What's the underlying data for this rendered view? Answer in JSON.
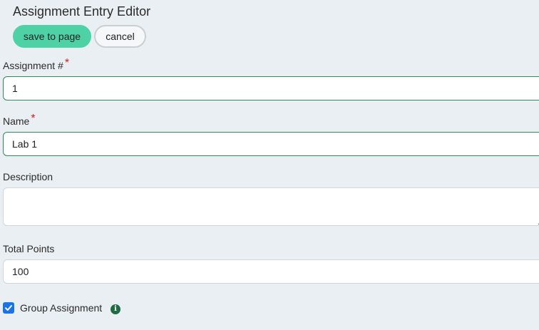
{
  "editor": {
    "title": "Assignment Entry Editor",
    "save_label": "save to page",
    "cancel_label": "cancel"
  },
  "fields": {
    "assignment_number": {
      "label": "Assignment #",
      "required_mark": "*",
      "value": "1"
    },
    "name": {
      "label": "Name",
      "required_mark": "*",
      "value": "Lab 1"
    },
    "description": {
      "label": "Description",
      "value": ""
    },
    "total_points": {
      "label": "Total Points",
      "value": "100"
    }
  },
  "group_assignment": {
    "label": "Group Assignment",
    "checked": true,
    "info_icon": "info-circle-icon"
  },
  "colors": {
    "background": "#e9eff2",
    "save_button": "#4fd1a6",
    "required": "#d9201e",
    "active_border": "#2e8b57",
    "checkbox": "#1a73e8",
    "info_icon": "#1e6b46"
  }
}
